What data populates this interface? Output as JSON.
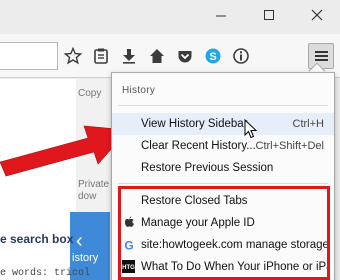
{
  "window": {
    "minimize_icon": "minimize-icon",
    "maximize_icon": "maximize-icon",
    "close_icon": "close-icon"
  },
  "toolbar": {
    "icons": [
      "bookmark-star-icon",
      "reading-list-icon",
      "download-arrow-icon",
      "home-icon",
      "pocket-icon",
      "skype-icon",
      "info-icon"
    ],
    "menu_icon": "hamburger-menu-icon"
  },
  "page": {
    "side_copy": "Copy",
    "side_private": "Private",
    "side_window": "dow",
    "side_history": "istory",
    "search_text": "e search box",
    "words_text": "e words:  tricol"
  },
  "history_menu": {
    "title": "History",
    "items": [
      {
        "label": "View History Sidebar",
        "shortcut": "Ctrl+H"
      },
      {
        "label": "Clear Recent History...",
        "shortcut": "Ctrl+Shift+Del"
      },
      {
        "label": "Restore Previous Session",
        "shortcut": ""
      }
    ],
    "recent": [
      {
        "label": "Restore Closed Tabs",
        "icon": ""
      },
      {
        "label": "Manage your Apple ID",
        "icon": "apple-icon"
      },
      {
        "label": "site:howtogeek.com manage storage i...",
        "icon": "google-icon"
      },
      {
        "label": "What To Do When Your iPhone or iPa...",
        "icon": "htg-icon"
      }
    ]
  },
  "colors": {
    "highlight_box": "#e0181e",
    "arrow": "#e0181e",
    "sidebar_accent": "#3f8ad8"
  }
}
